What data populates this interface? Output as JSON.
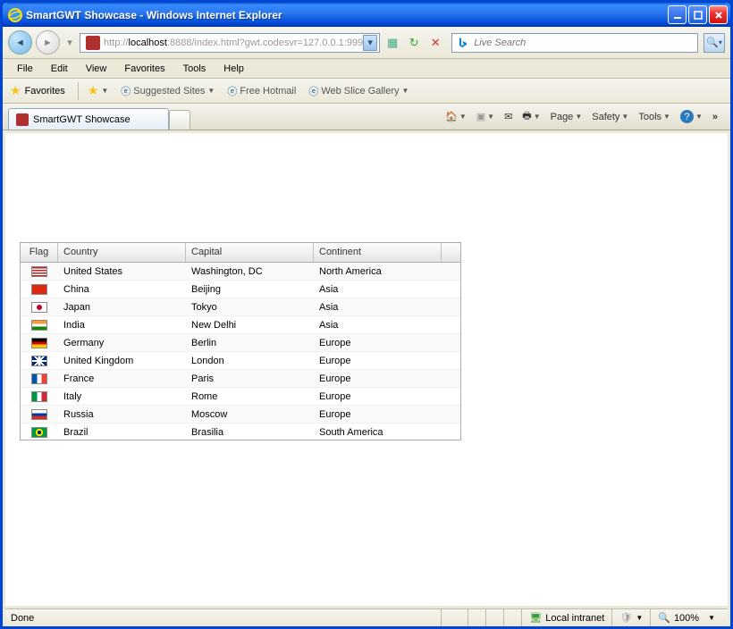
{
  "window": {
    "title": "SmartGWT Showcase - Windows Internet Explorer"
  },
  "nav": {
    "url_prefix": "http://",
    "url_host": "localhost",
    "url_rest": ":8888/index.html?gwt.codesvr=127.0.0.1:999"
  },
  "menu": {
    "file": "File",
    "edit": "Edit",
    "view": "View",
    "favorites": "Favorites",
    "tools": "Tools",
    "help": "Help"
  },
  "favbar": {
    "label": "Favorites",
    "suggested": "Suggested Sites",
    "hotmail": "Free Hotmail",
    "webslice": "Web Slice Gallery"
  },
  "tab": {
    "title": "SmartGWT Showcase"
  },
  "tabtools": {
    "page": "Page",
    "safety": "Safety",
    "tools": "Tools"
  },
  "search": {
    "placeholder": "Live Search"
  },
  "chart_data": {
    "type": "table",
    "columns": [
      "Flag",
      "Country",
      "Capital",
      "Continent"
    ],
    "rows": [
      {
        "flag_color": "us",
        "country": "United States",
        "capital": "Washington, DC",
        "continent": "North America"
      },
      {
        "flag_color": "cn",
        "country": "China",
        "capital": "Beijing",
        "continent": "Asia"
      },
      {
        "flag_color": "jp",
        "country": "Japan",
        "capital": "Tokyo",
        "continent": "Asia"
      },
      {
        "flag_color": "in",
        "country": "India",
        "capital": "New Delhi",
        "continent": "Asia"
      },
      {
        "flag_color": "de",
        "country": "Germany",
        "capital": "Berlin",
        "continent": "Europe"
      },
      {
        "flag_color": "gb",
        "country": "United Kingdom",
        "capital": "London",
        "continent": "Europe"
      },
      {
        "flag_color": "fr",
        "country": "France",
        "capital": "Paris",
        "continent": "Europe"
      },
      {
        "flag_color": "it",
        "country": "Italy",
        "capital": "Rome",
        "continent": "Europe"
      },
      {
        "flag_color": "ru",
        "country": "Russia",
        "capital": "Moscow",
        "continent": "Europe"
      },
      {
        "flag_color": "br",
        "country": "Brazil",
        "capital": "Brasilia",
        "continent": "South America"
      }
    ]
  },
  "flag_styles": {
    "us": "background:linear-gradient(to bottom,#b22 0,#b22 50%,#fff 50%,#fff 100%);background-size:100% 3px;position:relative;",
    "cn": "background:#de2910;",
    "jp": "background:#fff radial-gradient(circle at center,#bc002d 30%,#fff 32%);",
    "in": "background:linear-gradient(to bottom,#f93 33%,#fff 33%,#fff 66%,#128807 66%);",
    "de": "background:linear-gradient(to bottom,#000 33%,#d00 33%,#d00 66%,#fc0 66%);",
    "gb": "background:#00247d;background-image:linear-gradient(45deg,transparent 45%,#fff 45%,#fff 55%,transparent 55%),linear-gradient(-45deg,transparent 45%,#fff 45%,#fff 55%,transparent 55%),linear-gradient(to right,transparent 42%,#fff 42%,#fff 58%,transparent 58%),linear-gradient(to bottom,transparent 38%,#fff 38%,#fff 62%,transparent 62%),linear-gradient(to right,transparent 46%,#cf142b 46%,#cf142b 54%,transparent 54%),linear-gradient(to bottom,transparent 44%,#cf142b 44%,#cf142b 56%,transparent 56%);",
    "fr": "background:linear-gradient(to right,#0055a4 33%,#fff 33%,#fff 66%,#ef4135 66%);",
    "it": "background:linear-gradient(to right,#009246 33%,#fff 33%,#fff 66%,#ce2b37 66%);",
    "ru": "background:linear-gradient(to bottom,#fff 33%,#0039a6 33%,#0039a6 66%,#d52b1e 66%);",
    "br": "background:#009b3a radial-gradient(circle at center,#002776 22%,#fedf00 24%,#fedf00 42%,#009b3a 44%);"
  },
  "status": {
    "left": "Done",
    "zone": "Local intranet",
    "zoom": "100%"
  }
}
